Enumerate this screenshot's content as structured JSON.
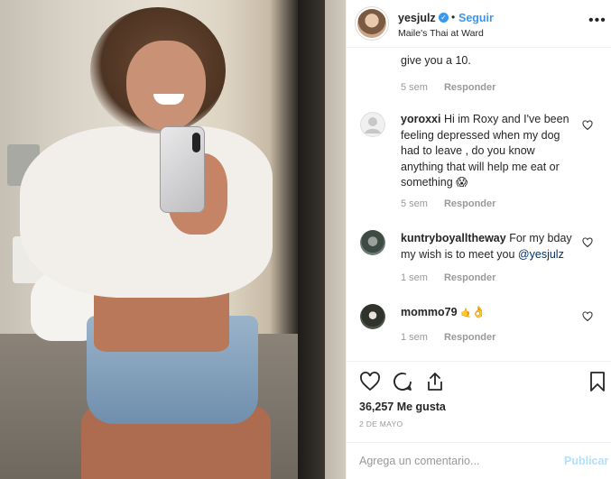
{
  "header": {
    "username": "yesjulz",
    "separator": "•",
    "follow_label": "Seguir",
    "location": "Maile's Thai at Ward",
    "verified_glyph": "✓"
  },
  "comments": {
    "first": {
      "text_tail": "give you a 10.",
      "time": "5 sem",
      "reply": "Responder"
    },
    "items": [
      {
        "username": "yoroxxi",
        "lines": [
          "Hi im Roxy and I've been",
          "feeling depressed when my dog",
          "had to leave , do you know",
          "anything that will help me eat or",
          "something 😱"
        ],
        "time": "5 sem",
        "reply": "Responder",
        "avatar_icon": "default-avatar-icon"
      },
      {
        "username": "kuntryboyalltheway",
        "text_first": "For my bday",
        "text_second": "my wish is to meet you",
        "mention": "@yesjulz",
        "time": "1 sem",
        "reply": "Responder",
        "avatar_icon": "photo-avatar"
      },
      {
        "username": "mommo79",
        "text": "👌",
        "prefix_glyph": "🤙",
        "time": "1 sem",
        "reply": "Responder",
        "avatar_icon": "photo-avatar"
      }
    ]
  },
  "actions": {
    "likes_text": "36,257 Me gusta",
    "date": "2 DE MAYO",
    "icons": [
      "heart-icon",
      "comment-icon",
      "share-icon",
      "bookmark-icon"
    ]
  },
  "composer": {
    "placeholder": "Agrega un comentario...",
    "publish_label": "Publicar"
  },
  "colors": {
    "link_blue": "#3897f0",
    "muted": "#999999",
    "publish_disabled": "#b2dffc"
  }
}
